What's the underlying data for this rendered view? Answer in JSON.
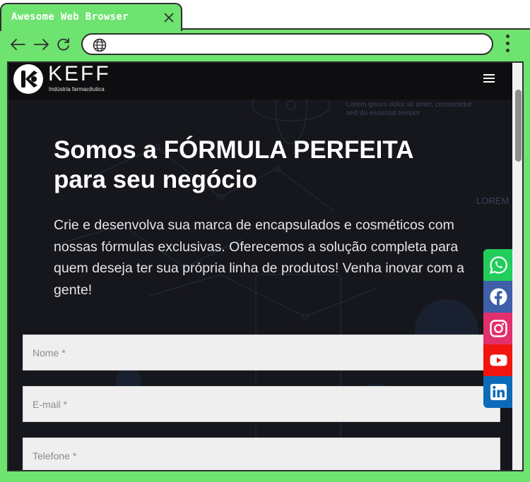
{
  "browser": {
    "tab_title": "Awesome Web Browser",
    "address": "",
    "colors": {
      "chrome": "#6ee36f",
      "outline": "#2f2f2f"
    }
  },
  "site": {
    "logo": {
      "wordmark": "KEFF",
      "tagline": "Indústria farmacêutica"
    },
    "hero": {
      "title_line1": "Somos a FÓRMULA PERFEITA",
      "title_line2": "para seu negócio",
      "paragraph": "Crie e desenvolva sua marca de encapsulados e cosméticos com nossas fórmulas exclusivas. Oferecemos a solução completa para quem deseja ter sua própria linha de produtos! Venha inovar com a gente!"
    },
    "form": {
      "name_placeholder": "Nome *",
      "email_placeholder": "E-mail *",
      "phone_placeholder": "Telefone *"
    },
    "social": [
      {
        "network": "whatsapp",
        "icon": "whatsapp-icon",
        "color": "#22cd5b"
      },
      {
        "network": "facebook",
        "icon": "facebook-icon",
        "color": "#3f5fa8"
      },
      {
        "network": "instagram",
        "icon": "instagram-icon",
        "color": "#e1306c"
      },
      {
        "network": "youtube",
        "icon": "youtube-icon",
        "color": "#f2140f"
      },
      {
        "network": "linkedin",
        "icon": "linkedin-icon",
        "color": "#0c6bb8"
      }
    ],
    "colors": {
      "background": "#16171d",
      "header": "#0e0e10",
      "field": "#efefef"
    }
  }
}
